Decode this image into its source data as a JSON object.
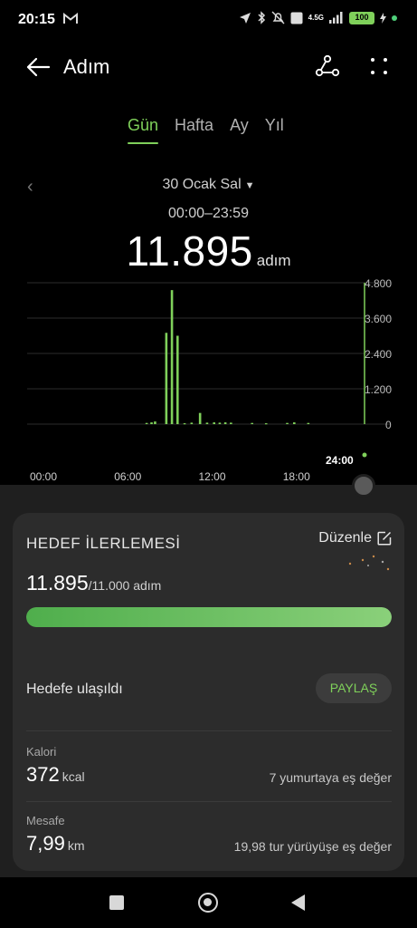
{
  "status_bar": {
    "time": "20:15",
    "network_label": "4.5G",
    "battery": "100"
  },
  "app_bar": {
    "title": "Adım"
  },
  "tabs": [
    {
      "label": "Gün",
      "active": true
    },
    {
      "label": "Hafta",
      "active": false
    },
    {
      "label": "Ay",
      "active": false
    },
    {
      "label": "Yıl",
      "active": false
    }
  ],
  "date_selector": {
    "date": "30 Ocak Sal",
    "time_range": "00:00–23:59"
  },
  "summary": {
    "steps": "11.895",
    "unit": "adım"
  },
  "chart_data": {
    "type": "bar",
    "x_tick_labels": [
      "00:00",
      "06:00",
      "12:00",
      "18:00",
      "24:00"
    ],
    "y_tick_labels": [
      "4.800",
      "3.600",
      "2.400",
      "1.200",
      "0"
    ],
    "ylim": [
      0,
      4800
    ],
    "xlim_hours": [
      0,
      24
    ],
    "bars": [
      {
        "hour": 8.5,
        "value": 40
      },
      {
        "hour": 8.85,
        "value": 60
      },
      {
        "hour": 9.1,
        "value": 90
      },
      {
        "hour": 9.9,
        "value": 3100
      },
      {
        "hour": 10.3,
        "value": 4550
      },
      {
        "hour": 10.7,
        "value": 3000
      },
      {
        "hour": 11.2,
        "value": 30
      },
      {
        "hour": 11.7,
        "value": 50
      },
      {
        "hour": 12.3,
        "value": 380
      },
      {
        "hour": 12.8,
        "value": 50
      },
      {
        "hour": 13.3,
        "value": 60
      },
      {
        "hour": 13.7,
        "value": 50
      },
      {
        "hour": 14.1,
        "value": 60
      },
      {
        "hour": 14.5,
        "value": 50
      },
      {
        "hour": 16.0,
        "value": 40
      },
      {
        "hour": 17.0,
        "value": 30
      },
      {
        "hour": 18.5,
        "value": 40
      },
      {
        "hour": 19.0,
        "value": 60
      },
      {
        "hour": 20.0,
        "value": 40
      }
    ],
    "grid": true,
    "colors": {
      "bar": "#7fd05a",
      "grid": "#2c2c2c",
      "cursor": "#7fd05a"
    }
  },
  "goal_card": {
    "title": "HEDEF İLERLEMESİ",
    "edit_label": "Düzenle",
    "progress_value": "11.895",
    "progress_target": "/11.000 adım",
    "progress_fraction": 1.0,
    "goal_reached": "Hedefe ulaşıldı",
    "share_label": "PAYLAŞ"
  },
  "metrics": [
    {
      "label": "Kalori",
      "value": "372",
      "unit": "kcal",
      "equivalent": "7 yumurtaya eş değer"
    },
    {
      "label": "Mesafe",
      "value": "7,99",
      "unit": "km",
      "equivalent": "19,98 tur yürüyüşe eş değer"
    }
  ],
  "colors": {
    "accent": "#7fd05a",
    "background": "#000000",
    "card": "#2c2c2c"
  }
}
